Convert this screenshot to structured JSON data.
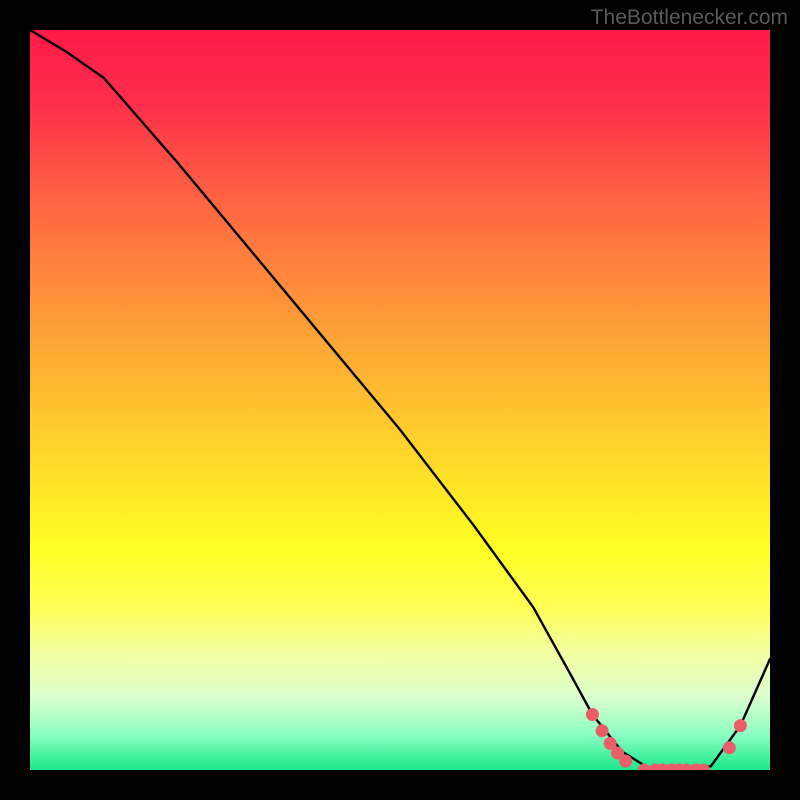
{
  "watermark": "TheBottlenecker.com",
  "chart_data": {
    "type": "line",
    "title": "",
    "xlabel": "",
    "ylabel": "",
    "xlim": [
      0,
      100
    ],
    "ylim": [
      0,
      100
    ],
    "series": [
      {
        "name": "curve",
        "x": [
          0,
          5,
          10,
          20,
          30,
          40,
          50,
          60,
          68,
          73,
          76,
          80,
          84,
          88,
          92,
          96,
          100
        ],
        "y": [
          100,
          97,
          93.5,
          82,
          70,
          58,
          46,
          33,
          22,
          13,
          7.5,
          2.5,
          0,
          0,
          0.5,
          6,
          15
        ],
        "color": "#000000"
      }
    ],
    "markers": [
      {
        "x": 76.0,
        "y": 7.5
      },
      {
        "x": 77.3,
        "y": 5.3
      },
      {
        "x": 78.4,
        "y": 3.6
      },
      {
        "x": 79.4,
        "y": 2.3
      },
      {
        "x": 80.5,
        "y": 1.2
      },
      {
        "x": 83.0,
        "y": 0.0
      },
      {
        "x": 84.5,
        "y": 0.0
      },
      {
        "x": 85.5,
        "y": 0.0
      },
      {
        "x": 86.7,
        "y": 0.0
      },
      {
        "x": 87.7,
        "y": 0.0
      },
      {
        "x": 88.7,
        "y": 0.0
      },
      {
        "x": 90.0,
        "y": 0.0
      },
      {
        "x": 91.0,
        "y": 0.0
      },
      {
        "x": 94.5,
        "y": 3.0
      },
      {
        "x": 96.0,
        "y": 6.0
      }
    ],
    "marker_style": {
      "shape": "circle",
      "fill": "#ec5d6a",
      "radius_px": 6.5
    },
    "gradient_stops": [
      {
        "pos": 0.0,
        "color": "#ff1a48"
      },
      {
        "pos": 0.5,
        "color": "#ffbf2f"
      },
      {
        "pos": 0.7,
        "color": "#ffff22"
      },
      {
        "pos": 0.95,
        "color": "#8fffc4"
      },
      {
        "pos": 1.0,
        "color": "#19e88a"
      }
    ]
  }
}
